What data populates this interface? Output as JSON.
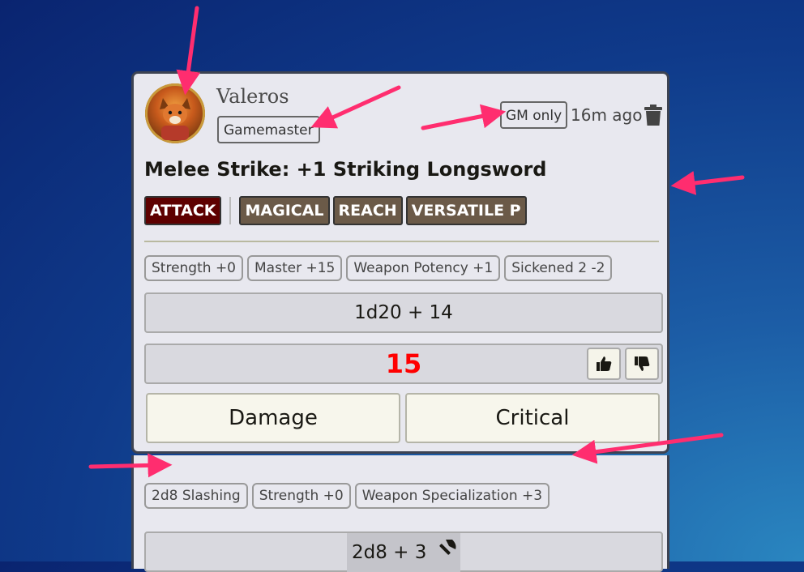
{
  "message": {
    "actor_name": "Valeros",
    "author_badge": "Gamemaster",
    "visibility": "GM only",
    "timestamp": "16m ago",
    "delete_icon": "trash-icon",
    "title": "Melee Strike: +1 Striking Longsword",
    "tags": {
      "action": "ATTACK",
      "traits": [
        "MAGICAL",
        "REACH",
        "VERSATILE P"
      ]
    },
    "modifiers": [
      "Strength +0",
      "Master +15",
      "Weapon Potency +1",
      "Sickened 2 -2"
    ],
    "roll": {
      "formula": "1d20 + 14",
      "total": "15",
      "total_color": "#ff0000"
    },
    "feedback": {
      "up_icon": "thumbs-up-icon",
      "down_icon": "thumbs-down-icon"
    },
    "buttons": {
      "damage": "Damage",
      "critical": "Critical"
    }
  },
  "damage_message": {
    "modifiers": [
      "2d8 Slashing",
      "Strength +0",
      "Weapon Specialization +3"
    ],
    "formula": "2d8 + 3",
    "icon": "axe-icon"
  },
  "annotation_color": "#ff2d6f"
}
